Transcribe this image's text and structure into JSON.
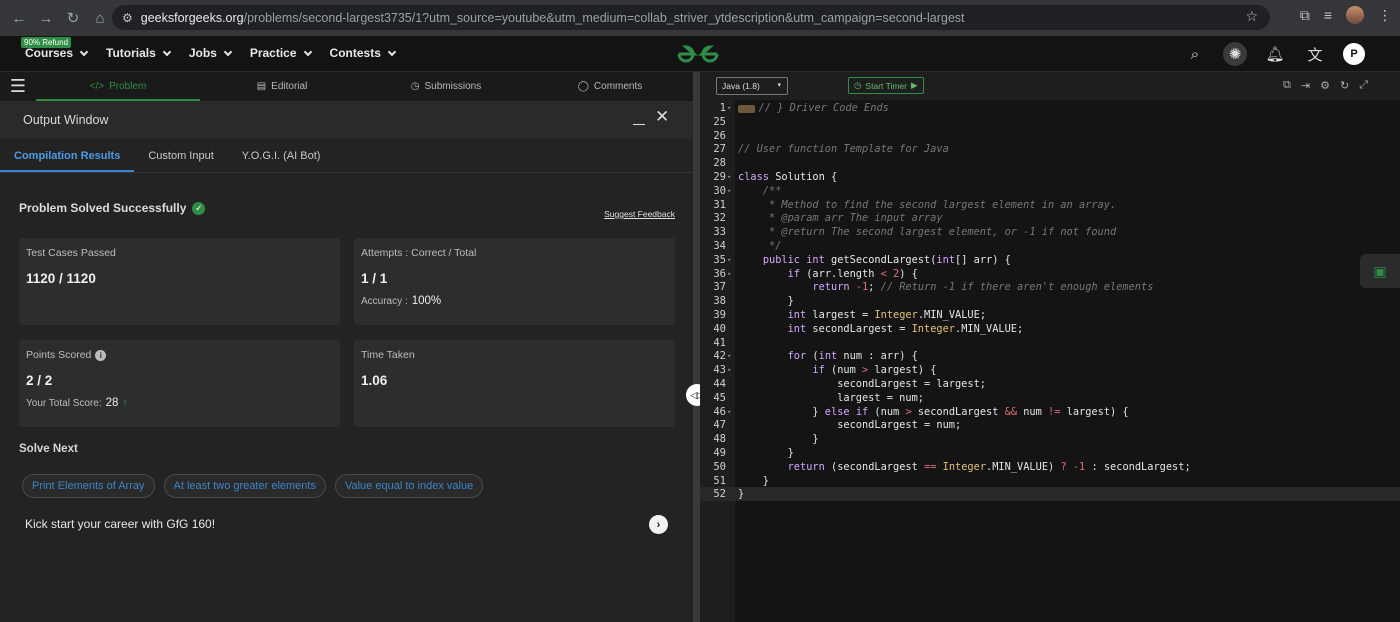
{
  "browser": {
    "url_domain": "geeksforgeeks.org",
    "url_path": "/problems/second-largest3735/1?utm_source=youtube&utm_medium=collab_striver_ytdescription&utm_campaign=second-largest"
  },
  "gfg_nav": {
    "refund_badge": "90% Refund",
    "menu": [
      "Courses",
      "Tutorials",
      "Jobs",
      "Practice",
      "Contests"
    ],
    "avatar_letter": "P"
  },
  "problem_tabs": [
    {
      "label": "Problem",
      "icon": "</>"
    },
    {
      "label": "Editorial",
      "icon": "▤"
    },
    {
      "label": "Submissions",
      "icon": "◷"
    },
    {
      "label": "Comments",
      "icon": "◯"
    }
  ],
  "output": {
    "title": "Output Window",
    "tabs": [
      "Compilation Results",
      "Custom Input",
      "Y.O.G.I. (AI Bot)"
    ],
    "status": "Problem Solved Successfully",
    "feedback": "Suggest Feedback",
    "test_cases": {
      "label": "Test Cases Passed",
      "value": "1120 / 1120"
    },
    "attempts": {
      "label": "Attempts : Correct / Total",
      "value": "1 / 1",
      "accuracy_label": "Accuracy :",
      "accuracy_value": "100%"
    },
    "points": {
      "label": "Points Scored",
      "value": "2 / 2",
      "total_label": "Your Total Score:",
      "total_value": "28"
    },
    "time": {
      "label": "Time Taken",
      "value": "1.06"
    },
    "solve_next_title": "Solve Next",
    "solve_next": [
      "Print Elements of Array",
      "At least two greater elements",
      "Value equal to index value"
    ],
    "kick": "Kick start your career with GfG 160!"
  },
  "editor": {
    "language": "Java (1.8)",
    "timer": "Start Timer",
    "line_numbers": [
      "1",
      "25",
      "26",
      "27",
      "28",
      "29",
      "30",
      "31",
      "32",
      "33",
      "34",
      "35",
      "36",
      "37",
      "38",
      "39",
      "40",
      "41",
      "42",
      "43",
      "44",
      "45",
      "46",
      "47",
      "48",
      "49",
      "50",
      "51",
      "52"
    ],
    "code": [
      "// } Driver Code Ends",
      "",
      "",
      "// User function Template for Java",
      "",
      "class Solution {",
      "    /**",
      "     * Method to find the second largest element in an array.",
      "     * @param arr The input array",
      "     * @return The second largest element, or -1 if not found",
      "     */",
      "    public int getSecondLargest(int[] arr) {",
      "        if (arr.length < 2) {",
      "            return -1; // Return -1 if there aren't enough elements",
      "        }",
      "        int largest = Integer.MIN_VALUE;",
      "        int secondLargest = Integer.MIN_VALUE;",
      "",
      "        for (int num : arr) {",
      "            if (num > largest) {",
      "                secondLargest = largest;",
      "                largest = num;",
      "            } else if (num > secondLargest && num != largest) {",
      "                secondLargest = num;",
      "            }",
      "        }",
      "        return (secondLargest == Integer.MIN_VALUE) ? -1 : secondLargest;",
      "    }",
      "}"
    ]
  }
}
